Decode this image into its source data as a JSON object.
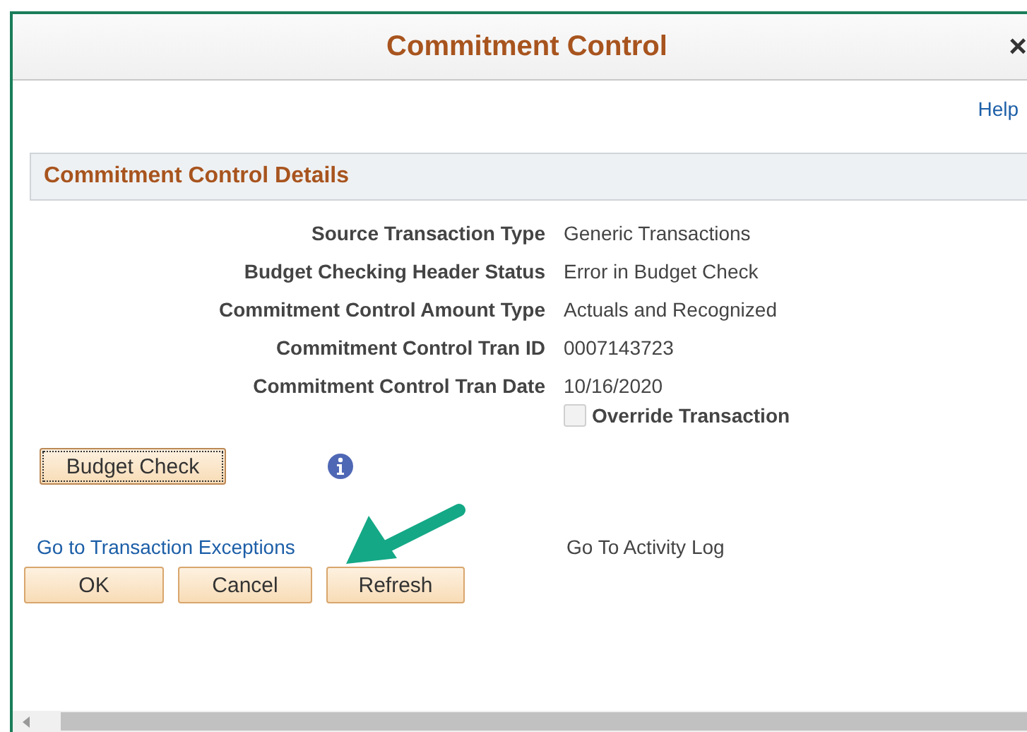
{
  "window": {
    "title": "Commitment Control",
    "close": "×"
  },
  "help_link": "Help",
  "section": {
    "title": "Commitment Control Details"
  },
  "fields": [
    {
      "label": "Source Transaction Type",
      "value": "Generic Transactions"
    },
    {
      "label": "Budget Checking Header Status",
      "value": "Error in Budget Check"
    },
    {
      "label": "Commitment Control Amount Type",
      "value": "Actuals and Recognized"
    },
    {
      "label": "Commitment Control Tran ID",
      "value": "0007143723"
    },
    {
      "label": "Commitment Control Tran Date",
      "value": "10/16/2020"
    }
  ],
  "override": {
    "label": "Override Transaction",
    "checked": false,
    "disabled": true
  },
  "budget_check_button": "Budget Check",
  "links": [
    {
      "label": "Go to Transaction Exceptions",
      "kind": "link"
    },
    {
      "label": "Go To Activity Log",
      "kind": "disabled"
    }
  ],
  "buttons": [
    "OK",
    "Cancel",
    "Refresh"
  ]
}
